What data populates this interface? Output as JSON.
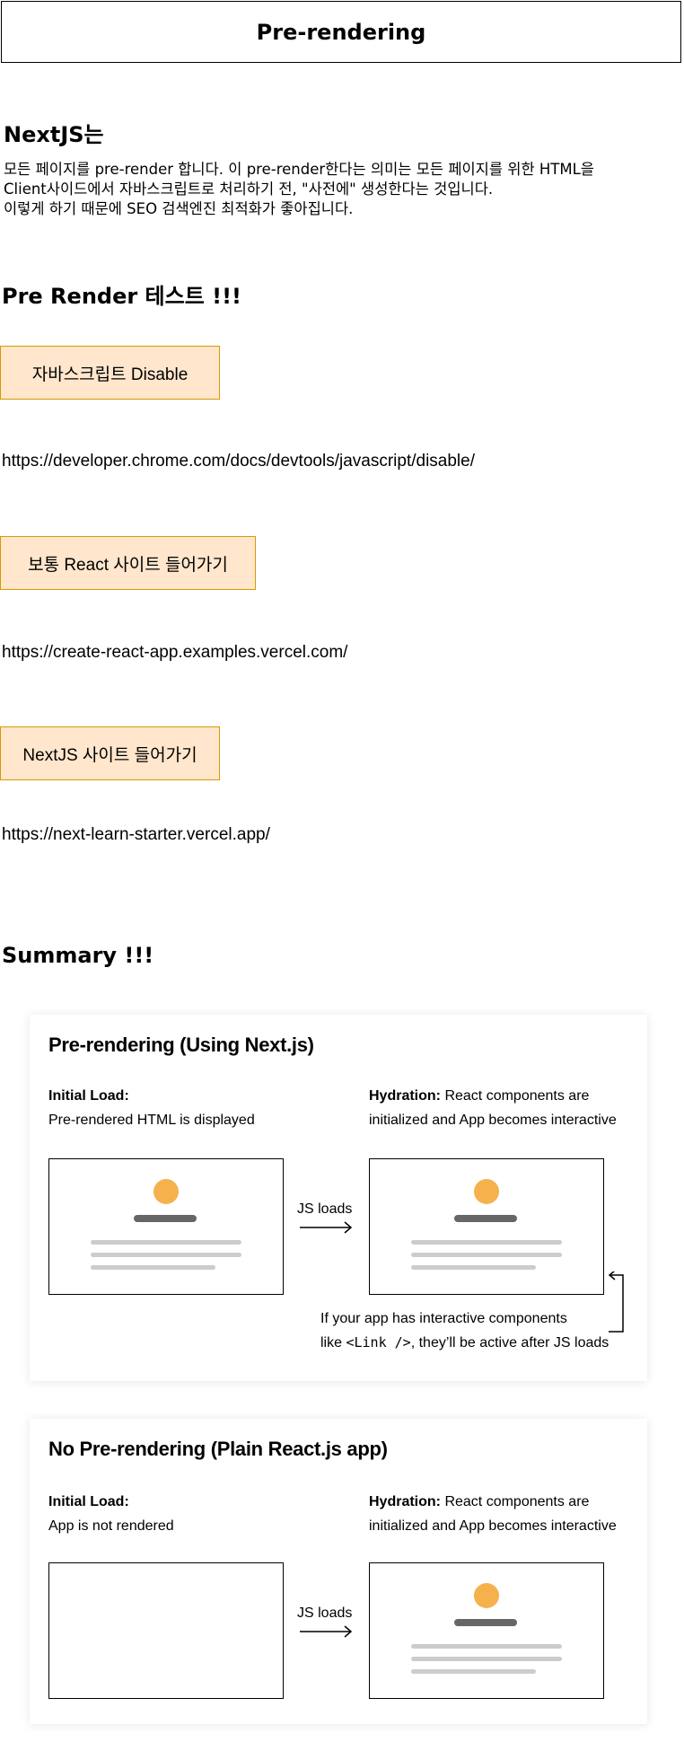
{
  "header": {
    "title": "Pre-rendering"
  },
  "intro": {
    "heading": "NextJS는",
    "lines": [
      "모든 페이지를 pre-render 합니다. 이 pre-render한다는 의미는 모든 페이지를 위한 HTML을",
      "Client사이드에서 자바스크립트로  처리하기 전, \"사전에\" 생성한다는 것입니다.",
      "이렇게 하기 때문에 SEO 검색엔진 최적화가 좋아집니다."
    ]
  },
  "test": {
    "heading": "Pre Render 테스트 !!!",
    "items": [
      {
        "button": "자바스크립트 Disable",
        "url": "https://developer.chrome.com/docs/devtools/javascript/disable/"
      },
      {
        "button": "보통 React 사이트 들어가기",
        "url": "https://create-react-app.examples.vercel.com/"
      },
      {
        "button": "NextJS 사이트 들어가기",
        "url": "https://next-learn-starter.vercel.app/"
      }
    ]
  },
  "summary": {
    "heading": "Summary !!!",
    "colors": {
      "dot": "#f5b14c",
      "bar": "#666666",
      "line": "#cccccc"
    },
    "cards": [
      {
        "title": "Pre-rendering (Using Next.js)",
        "initial_label": "Initial Load:",
        "initial_desc": "Pre-rendered HTML is displayed",
        "hydration_label": "Hydration:",
        "hydration_rest": " React components are",
        "hydration_line2": "initialized and App becomes interactive",
        "arrow_label": "JS loads",
        "note_line1": "If your app has interactive components",
        "note_prefix": "like ",
        "note_code": "<Link />",
        "note_suffix": ", they’ll be active after JS loads"
      },
      {
        "title": "No Pre-rendering (Plain React.js app)",
        "initial_label": "Initial Load:",
        "initial_desc": "App is not rendered",
        "hydration_label": "Hydration:",
        "hydration_rest": " React components are",
        "hydration_line2": "initialized and App becomes interactive",
        "arrow_label": "JS loads"
      }
    ]
  }
}
